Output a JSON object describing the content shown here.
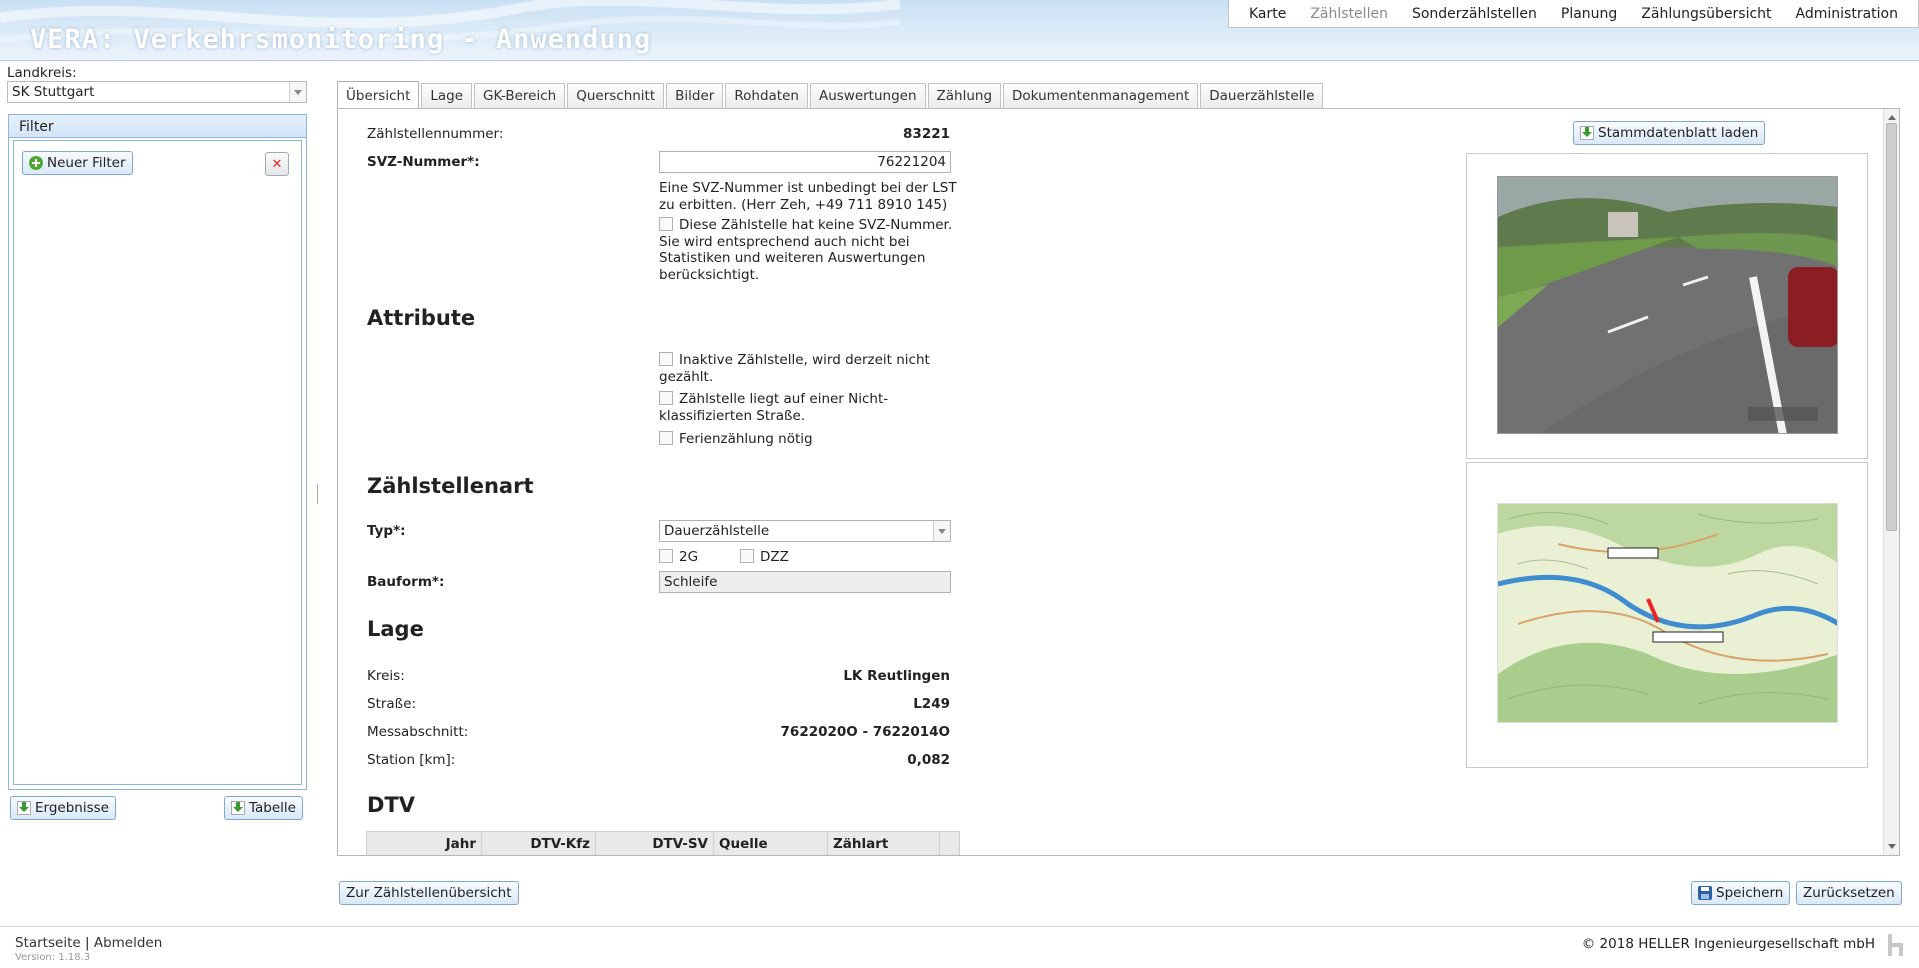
{
  "header": {
    "title": "VERA: Verkehrsmonitoring - Anwendung",
    "nav": [
      {
        "label": "Karte",
        "disabled": false
      },
      {
        "label": "Zählstellen",
        "disabled": true
      },
      {
        "label": "Sonderzählstellen",
        "disabled": false
      },
      {
        "label": "Planung",
        "disabled": false
      },
      {
        "label": "Zählungsübersicht",
        "disabled": false
      },
      {
        "label": "Administration",
        "disabled": false
      }
    ]
  },
  "sidebar": {
    "landkreis_label": "Landkreis:",
    "landkreis_value": "SK Stuttgart",
    "filter_title": "Filter",
    "new_filter_label": "Neuer Filter",
    "ergebnisse_label": "Ergebnisse",
    "tabelle_label": "Tabelle"
  },
  "tabs": [
    {
      "label": "Übersicht",
      "active": true
    },
    {
      "label": "Lage",
      "active": false
    },
    {
      "label": "GK-Bereich",
      "active": false
    },
    {
      "label": "Querschnitt",
      "active": false
    },
    {
      "label": "Bilder",
      "active": false
    },
    {
      "label": "Rohdaten",
      "active": false
    },
    {
      "label": "Auswertungen",
      "active": false
    },
    {
      "label": "Zählung",
      "active": false
    },
    {
      "label": "Dokumentenmanagement",
      "active": false
    },
    {
      "label": "Dauerzählstelle",
      "active": false
    }
  ],
  "overview": {
    "zaehlstellennummer_label": "Zählstellennummer:",
    "zaehlstellennummer_value": "83221",
    "svz_label": "SVZ-Nummer*:",
    "svz_value": "76221204",
    "svz_note_1": "Eine SVZ-Nummer ist unbedingt bei der LST",
    "svz_note_2": "zu erbitten. (Herr Zeh, +49 711 8910 145)",
    "no_svz_line1": "Diese Zählstelle hat keine SVZ-Nummer.",
    "no_svz_line2": "Sie wird entsprechend auch nicht bei",
    "no_svz_line3": "Statistiken und weiteren Auswertungen",
    "no_svz_line4": "berücksichtigt.",
    "stammdaten_label": "Stammdatenblatt laden"
  },
  "attribute": {
    "title": "Attribute",
    "inaktiv_1": "Inaktive Zählstelle, wird derzeit nicht",
    "inaktiv_2": "gezählt.",
    "nicht_klass_1": "Zählstelle liegt auf einer Nicht-",
    "nicht_klass_2": "klassifizierten Straße.",
    "ferien": "Ferienzählung nötig"
  },
  "zaehlstellenart": {
    "title": "Zählstellenart",
    "typ_label": "Typ*:",
    "typ_value": "Dauerzählstelle",
    "opt_2g": "2G",
    "opt_dzz": "DZZ",
    "bauform_label": "Bauform*:",
    "bauform_value": "Schleife"
  },
  "lage": {
    "title": "Lage",
    "kreis_label": "Kreis:",
    "kreis_value": "LK Reutlingen",
    "strasse_label": "Straße:",
    "strasse_value": "L249",
    "messabschnitt_label": "Messabschnitt:",
    "messabschnitt_value": "7622020O - 7622014O",
    "station_label": "Station [km]:",
    "station_value": "0,082"
  },
  "dtv": {
    "title": "DTV",
    "columns": [
      "Jahr",
      "DTV-Kfz",
      "DTV-SV",
      "Quelle",
      "Zählart"
    ]
  },
  "actions": {
    "back_label": "Zur Zählstellenübersicht",
    "save_label": "Speichern",
    "reset_label": "Zurücksetzen"
  },
  "footer": {
    "start": "Startseite",
    "separator": "|",
    "logout": "Abmelden",
    "version": "Version: 1.18.3",
    "copyright": "© 2018 HELLER Ingenieurgesellschaft mbH"
  },
  "colors": {
    "header_bg": "#d6e8f7",
    "accent_border": "#8fb4d9",
    "button_border": "#7fa8d1"
  }
}
